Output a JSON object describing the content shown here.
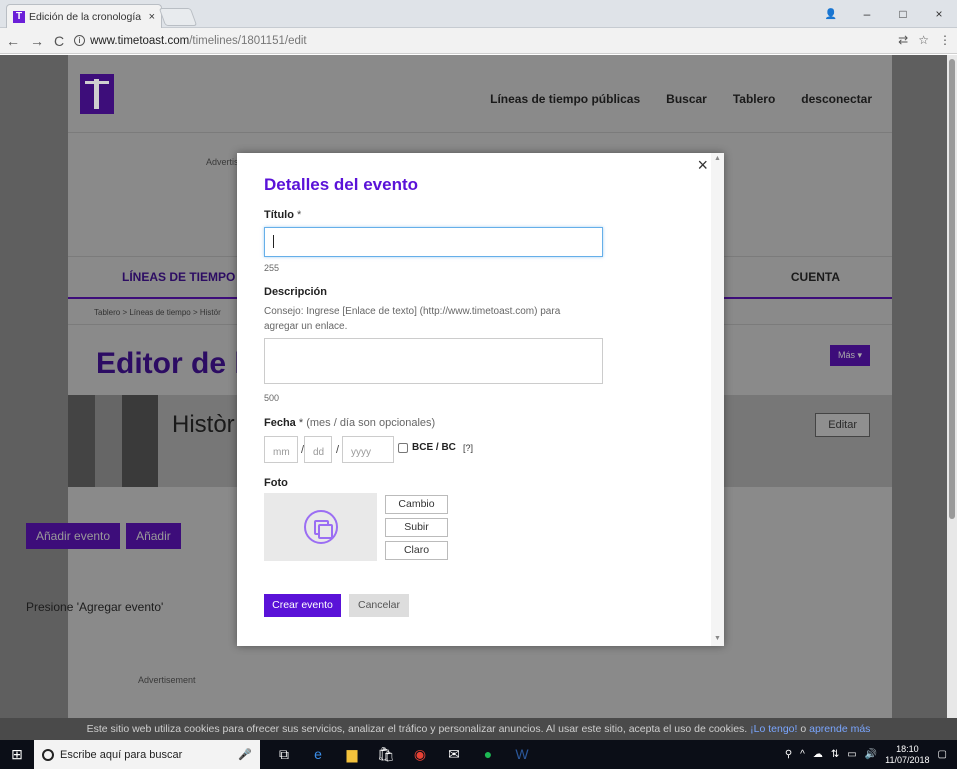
{
  "browser": {
    "tab_title": "Edición de la cronología",
    "tab_close": "×",
    "url_domain": "www.timetoast.com",
    "url_path": "/timelines/1801151/edit",
    "nav_back": "←",
    "nav_forward": "→",
    "nav_reload": "C",
    "url_info": "i",
    "win_min": "–",
    "win_max": "□",
    "win_close": "×"
  },
  "site": {
    "nav": [
      "Líneas de tiempo públicas",
      "Buscar",
      "Tablero",
      "desconectar"
    ],
    "ad_label": "Advertis",
    "tab_left": "LÍNEAS DE TIEMPO",
    "tab_right": "CUENTA",
    "breadcrumb": "Tablero > Líneas de tiempo > Histör",
    "page_title": "Editor de l",
    "mas_button": "Más ▾",
    "timeline_name": "Històr",
    "edit_button": "Editar",
    "add_event_button": "Añadir evento",
    "add_other_button": "Añadir",
    "press_text": "Presione 'Agregar evento'",
    "ad_bottom": "Advertisement"
  },
  "modal": {
    "close": "×",
    "title": "Detalles del evento",
    "title_label": "Título",
    "required_mark": "*",
    "title_value": "",
    "title_counter": "255",
    "desc_label": "Descripción",
    "desc_hint_1": "Consejo: Ingrese [Enlace de texto] (http://www.timetoast.com) para",
    "desc_hint_2": "agregar un enlace.",
    "desc_value": "",
    "desc_counter": "500",
    "date_label": "Fecha",
    "date_sub": "(mes / día son opcionales)",
    "month_placeholder": "mm",
    "day_placeholder": "dd",
    "year_placeholder": "yyyy",
    "date_sep": "/",
    "bce_label": "BCE / BC",
    "bce_help": "[?]",
    "photo_label": "Foto",
    "photo_change": "Cambio",
    "photo_upload": "Subir",
    "photo_clear": "Claro",
    "create_button": "Crear evento",
    "cancel_button": "Cancelar"
  },
  "cookie_bar": {
    "text": "Este sitio web utiliza cookies para ofrecer sus servicios, analizar el tráfico y personalizar anuncios. Al usar este sitio, acepta el uso de cookies.",
    "accept_link": "¡Lo tengo!",
    "or": "o",
    "more_link": "aprende más"
  },
  "taskbar": {
    "search_placeholder": "Escribe aquí para buscar",
    "time": "18:10",
    "date": "11/07/2018"
  },
  "colors": {
    "brand_purple": "#5a12d8",
    "overlay": "#5f5f5f"
  }
}
